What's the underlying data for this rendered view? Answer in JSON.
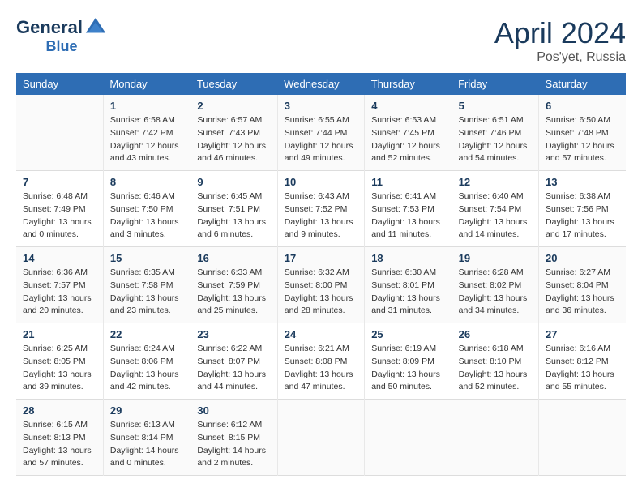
{
  "header": {
    "logo_line1": "General",
    "logo_line2": "Blue",
    "month": "April 2024",
    "location": "Pos'yet, Russia"
  },
  "columns": [
    "Sunday",
    "Monday",
    "Tuesday",
    "Wednesday",
    "Thursday",
    "Friday",
    "Saturday"
  ],
  "weeks": [
    [
      {
        "day": "",
        "info": ""
      },
      {
        "day": "1",
        "info": "Sunrise: 6:58 AM\nSunset: 7:42 PM\nDaylight: 12 hours\nand 43 minutes."
      },
      {
        "day": "2",
        "info": "Sunrise: 6:57 AM\nSunset: 7:43 PM\nDaylight: 12 hours\nand 46 minutes."
      },
      {
        "day": "3",
        "info": "Sunrise: 6:55 AM\nSunset: 7:44 PM\nDaylight: 12 hours\nand 49 minutes."
      },
      {
        "day": "4",
        "info": "Sunrise: 6:53 AM\nSunset: 7:45 PM\nDaylight: 12 hours\nand 52 minutes."
      },
      {
        "day": "5",
        "info": "Sunrise: 6:51 AM\nSunset: 7:46 PM\nDaylight: 12 hours\nand 54 minutes."
      },
      {
        "day": "6",
        "info": "Sunrise: 6:50 AM\nSunset: 7:48 PM\nDaylight: 12 hours\nand 57 minutes."
      }
    ],
    [
      {
        "day": "7",
        "info": "Sunrise: 6:48 AM\nSunset: 7:49 PM\nDaylight: 13 hours\nand 0 minutes."
      },
      {
        "day": "8",
        "info": "Sunrise: 6:46 AM\nSunset: 7:50 PM\nDaylight: 13 hours\nand 3 minutes."
      },
      {
        "day": "9",
        "info": "Sunrise: 6:45 AM\nSunset: 7:51 PM\nDaylight: 13 hours\nand 6 minutes."
      },
      {
        "day": "10",
        "info": "Sunrise: 6:43 AM\nSunset: 7:52 PM\nDaylight: 13 hours\nand 9 minutes."
      },
      {
        "day": "11",
        "info": "Sunrise: 6:41 AM\nSunset: 7:53 PM\nDaylight: 13 hours\nand 11 minutes."
      },
      {
        "day": "12",
        "info": "Sunrise: 6:40 AM\nSunset: 7:54 PM\nDaylight: 13 hours\nand 14 minutes."
      },
      {
        "day": "13",
        "info": "Sunrise: 6:38 AM\nSunset: 7:56 PM\nDaylight: 13 hours\nand 17 minutes."
      }
    ],
    [
      {
        "day": "14",
        "info": "Sunrise: 6:36 AM\nSunset: 7:57 PM\nDaylight: 13 hours\nand 20 minutes."
      },
      {
        "day": "15",
        "info": "Sunrise: 6:35 AM\nSunset: 7:58 PM\nDaylight: 13 hours\nand 23 minutes."
      },
      {
        "day": "16",
        "info": "Sunrise: 6:33 AM\nSunset: 7:59 PM\nDaylight: 13 hours\nand 25 minutes."
      },
      {
        "day": "17",
        "info": "Sunrise: 6:32 AM\nSunset: 8:00 PM\nDaylight: 13 hours\nand 28 minutes."
      },
      {
        "day": "18",
        "info": "Sunrise: 6:30 AM\nSunset: 8:01 PM\nDaylight: 13 hours\nand 31 minutes."
      },
      {
        "day": "19",
        "info": "Sunrise: 6:28 AM\nSunset: 8:02 PM\nDaylight: 13 hours\nand 34 minutes."
      },
      {
        "day": "20",
        "info": "Sunrise: 6:27 AM\nSunset: 8:04 PM\nDaylight: 13 hours\nand 36 minutes."
      }
    ],
    [
      {
        "day": "21",
        "info": "Sunrise: 6:25 AM\nSunset: 8:05 PM\nDaylight: 13 hours\nand 39 minutes."
      },
      {
        "day": "22",
        "info": "Sunrise: 6:24 AM\nSunset: 8:06 PM\nDaylight: 13 hours\nand 42 minutes."
      },
      {
        "day": "23",
        "info": "Sunrise: 6:22 AM\nSunset: 8:07 PM\nDaylight: 13 hours\nand 44 minutes."
      },
      {
        "day": "24",
        "info": "Sunrise: 6:21 AM\nSunset: 8:08 PM\nDaylight: 13 hours\nand 47 minutes."
      },
      {
        "day": "25",
        "info": "Sunrise: 6:19 AM\nSunset: 8:09 PM\nDaylight: 13 hours\nand 50 minutes."
      },
      {
        "day": "26",
        "info": "Sunrise: 6:18 AM\nSunset: 8:10 PM\nDaylight: 13 hours\nand 52 minutes."
      },
      {
        "day": "27",
        "info": "Sunrise: 6:16 AM\nSunset: 8:12 PM\nDaylight: 13 hours\nand 55 minutes."
      }
    ],
    [
      {
        "day": "28",
        "info": "Sunrise: 6:15 AM\nSunset: 8:13 PM\nDaylight: 13 hours\nand 57 minutes."
      },
      {
        "day": "29",
        "info": "Sunrise: 6:13 AM\nSunset: 8:14 PM\nDaylight: 14 hours\nand 0 minutes."
      },
      {
        "day": "30",
        "info": "Sunrise: 6:12 AM\nSunset: 8:15 PM\nDaylight: 14 hours\nand 2 minutes."
      },
      {
        "day": "",
        "info": ""
      },
      {
        "day": "",
        "info": ""
      },
      {
        "day": "",
        "info": ""
      },
      {
        "day": "",
        "info": ""
      }
    ]
  ]
}
